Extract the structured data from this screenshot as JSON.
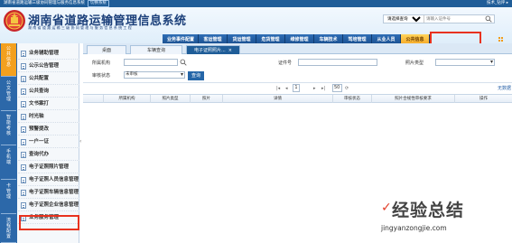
{
  "topbar": {
    "title": "湖南省道路运输三级协同管理与服务信息系统",
    "switch_label": "切换系统",
    "user": "技术_钻评 ▸"
  },
  "header": {
    "title": "湖南省道路运输管理信息系统",
    "subtitle": "湖 南 省 道 路 运 输 三 级 协 同 管 理 与 服 务 信 息 系 统 工 程",
    "search_scope": "请选择查询",
    "search_placeholder": "请输入证件号"
  },
  "nav": {
    "items": [
      {
        "label": "业务事件配置"
      },
      {
        "label": "客运管理"
      },
      {
        "label": "货运管理"
      },
      {
        "label": "危货管理"
      },
      {
        "label": "维修管理"
      },
      {
        "label": "车辆技术"
      },
      {
        "label": "驾培管理"
      },
      {
        "label": "从业人员"
      },
      {
        "label": "公共信息"
      }
    ],
    "active_index": 8
  },
  "sidebar": {
    "vtabs": [
      {
        "label": "公共信息"
      },
      {
        "label": "公文管理"
      },
      {
        "label": "智能考核"
      },
      {
        "label": "手机端"
      },
      {
        "label": "卡管理"
      },
      {
        "label": "流程配置"
      }
    ],
    "menu": [
      {
        "label": "业务辅助管理"
      },
      {
        "label": "公示公告管理"
      },
      {
        "label": "公共配置"
      },
      {
        "label": "公共查询"
      },
      {
        "label": "文书案打"
      },
      {
        "label": "时光轴"
      },
      {
        "label": "预警提改"
      },
      {
        "label": "一户一证"
      },
      {
        "label": "查询代办"
      },
      {
        "label": "电子证照照片管理"
      },
      {
        "label": "电子证照人员信息管理"
      },
      {
        "label": "电子证照车辆信息管理"
      },
      {
        "label": "电子证照企业信息管理"
      },
      {
        "label": "业务服务管理"
      }
    ],
    "highlighted_index": 9
  },
  "tabs": [
    {
      "label": "桌面"
    },
    {
      "label": "车辆查询"
    },
    {
      "label": "电子证照照片..."
    }
  ],
  "form": {
    "org_label": "所属机构",
    "cert_label": "证件号",
    "photo_type_label": "照片类型",
    "audit_label": "审核状态",
    "audit_value": "未审核",
    "query_button": "查询"
  },
  "pager": {
    "first": "|◂",
    "prev": "◂",
    "page": "1",
    "next": "▸",
    "last": "▸|",
    "page_size": "50",
    "no_data": "无数据"
  },
  "table": {
    "columns": [
      "所属机构",
      "照片类型",
      "照片",
      "详情",
      "审核状态",
      "照片合规性审核要求",
      "操作"
    ]
  },
  "watermark": {
    "text": "经验总结",
    "url": "jingyanzongjie.com"
  },
  "colors": {
    "primary": "#1f5d98",
    "nav_active": "#f5a623",
    "highlight": "#e8321e"
  }
}
